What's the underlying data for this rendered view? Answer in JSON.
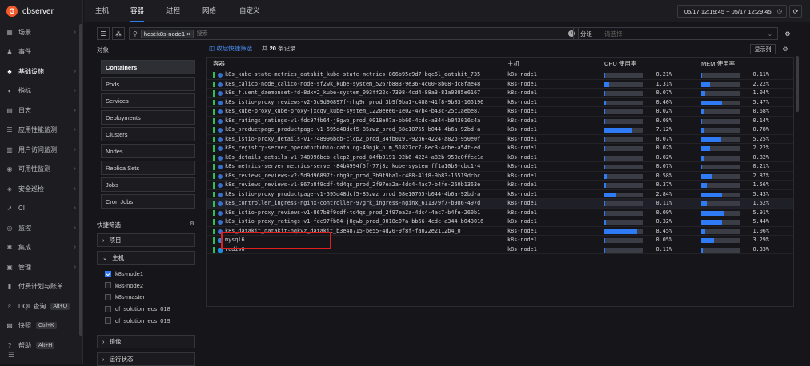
{
  "app": {
    "name": "observer"
  },
  "nav": [
    {
      "label": "场景",
      "icon": "scene-icon",
      "glyph": "▦",
      "chevron": true
    },
    {
      "label": "事件",
      "icon": "bell-icon",
      "glyph": "♟",
      "chevron": false
    },
    {
      "label": "基础设施",
      "icon": "infra-icon",
      "glyph": "♣",
      "chevron": true,
      "active": true
    },
    {
      "label": "指标",
      "icon": "metric-icon",
      "glyph": "◐",
      "chevron": true
    },
    {
      "label": "日志",
      "icon": "log-icon",
      "glyph": "▤",
      "chevron": true
    },
    {
      "label": "应用性能监测",
      "icon": "apm-icon",
      "glyph": "☰",
      "chevron": true
    },
    {
      "label": "用户访问监测",
      "icon": "rum-icon",
      "glyph": "▥",
      "chevron": true
    },
    {
      "label": "可用性监测",
      "icon": "dial-icon",
      "glyph": "◉",
      "chevron": true
    },
    {
      "label": "安全巡检",
      "icon": "shield-icon",
      "glyph": "◈",
      "chevron": true
    },
    {
      "label": "CI",
      "icon": "rocket-icon",
      "glyph": "➚",
      "chevron": true
    },
    {
      "label": "监控",
      "icon": "monitor-icon",
      "glyph": "◎",
      "chevron": true
    },
    {
      "label": "集成",
      "icon": "puzzle-icon",
      "glyph": "✱",
      "chevron": true
    },
    {
      "label": "管理",
      "icon": "manage-icon",
      "glyph": "▣",
      "chevron": true
    },
    {
      "label": "付费计划与账单",
      "icon": "billing-icon",
      "glyph": "▮",
      "chevron": false
    },
    {
      "label": "DQL 查询",
      "icon": "dql-icon",
      "glyph": "⌕",
      "chevron": false,
      "kbd": "Alt+Q"
    },
    {
      "label": "快照",
      "icon": "snapshot-icon",
      "glyph": "▩",
      "chevron": false,
      "kbd": "Ctrl+K"
    },
    {
      "label": "帮助",
      "icon": "help-icon",
      "glyph": "?",
      "chevron": false,
      "kbd": "Alt+H"
    }
  ],
  "tabs": [
    "主机",
    "容器",
    "进程",
    "网络",
    "自定义"
  ],
  "active_tab": "容器",
  "time_range": "05/17 12:19:45 ~ 05/17 12:29:45",
  "filter": {
    "chip": "host:k8s-node1",
    "search_placeholder": "搜索",
    "group_label": "分组",
    "group_placeholder": "请选择"
  },
  "objects_label": "对象",
  "objects": [
    "Containers",
    "Pods",
    "Services",
    "Deployments",
    "Clusters",
    "Nodes",
    "Replica Sets",
    "Jobs",
    "Cron Jobs"
  ],
  "quick_filter": {
    "title": "快捷筛选",
    "project": "项目",
    "host": "主机",
    "hosts": [
      {
        "name": "k8s-node1",
        "checked": true
      },
      {
        "name": "k8s-node2",
        "checked": false
      },
      {
        "name": "k8s-master",
        "checked": false
      },
      {
        "name": "df_solution_ecs_018",
        "checked": false
      },
      {
        "name": "df_solution_ecs_019",
        "checked": false
      }
    ],
    "image": "镜像",
    "run_state": "运行状态"
  },
  "table_top": {
    "view_link": "收起快捷筛选",
    "count_prefix": "共 ",
    "count": "20",
    "count_suffix": " 条记录",
    "columns_btn": "显示列"
  },
  "columns": {
    "name": "容器",
    "host": "主机",
    "cpu": "CPU 使用率",
    "mem": "MEM 使用率"
  },
  "rows": [
    {
      "name": "k8s_kube-state-metrics_datakit_kube-state-metrics-866b95c9d7-bqc6l_datakit_735",
      "host": "k8s-node1",
      "cpu": 0.21,
      "mem": 0.11,
      "type": "k8s"
    },
    {
      "name": "k8s_calico-node_calico-node-sf2wk_kube-system_5267b883-9e36-4c00-8b08-dc8fae48",
      "host": "k8s-node1",
      "cpu": 1.31,
      "mem": 2.22,
      "type": "k8s"
    },
    {
      "name": "k8s_fluent_daemonset-fd-8dxv2_kube-system_093ff22c-7398-4cd4-88a3-81a0085e6167",
      "host": "k8s-node1",
      "cpu": 0.07,
      "mem": 1.04,
      "type": "k8s"
    },
    {
      "name": "k8s_istio-proxy_reviews-v2-5d9d96897f-rhg9r_prod_3b9f9ba1-c488-41f8-9b83-165196",
      "host": "k8s-node1",
      "cpu": 0.4,
      "mem": 5.47,
      "type": "k8s"
    },
    {
      "name": "k8s_kube-proxy_kube-proxy-jxcqv_kube-system_1220eee6-1e02-47b4-b43c-25c1aebe87",
      "host": "k8s-node1",
      "cpu": 0.02,
      "mem": 0.68,
      "type": "k8s"
    },
    {
      "name": "k8s_ratings_ratings-v1-fdc97fb64-j8gwb_prod_0018e07a-bb66-4cdc-a344-b043016c4a",
      "host": "k8s-node1",
      "cpu": 0.08,
      "mem": 0.14,
      "type": "k8s"
    },
    {
      "name": "k8s_productpage_productpage-v1-595d48dcf5-85zwz_prod_68e10765-b044-4b6a-92bd-a",
      "host": "k8s-node1",
      "cpu": 7.12,
      "mem": 0.78,
      "type": "k8s"
    },
    {
      "name": "k8s_istio-proxy_details-v1-748996bcb-clcp2_prod_84fb0191-92b6-4224-a82b-950e0f",
      "host": "k8s-node1",
      "cpu": 0.07,
      "mem": 5.25,
      "type": "k8s"
    },
    {
      "name": "k8s_registry-server_operatorhubio-catalog-49njk_olm_51827cc7-8ec3-4cbe-a54f-ed",
      "host": "k8s-node1",
      "cpu": 0.02,
      "mem": 2.22,
      "type": "k8s"
    },
    {
      "name": "k8s_details_details-v1-748996bcb-clcp2_prod_84fb0191-92b6-4224-a82b-950e0ffee1a",
      "host": "k8s-node1",
      "cpu": 0.02,
      "mem": 0.82,
      "type": "k8s"
    },
    {
      "name": "k8s_metrics-server_metrics-server-84b4994f5f-77j8z_kube-system_ff1a10b0-cbc1-4",
      "host": "k8s-node1",
      "cpu": 0.07,
      "mem": 0.21,
      "type": "k8s"
    },
    {
      "name": "k8s_reviews_reviews-v2-5d9d96897f-rhg9r_prod_3b9f9ba1-c488-41f8-9b83-16519dcbc",
      "host": "k8s-node1",
      "cpu": 0.58,
      "mem": 2.87,
      "type": "k8s"
    },
    {
      "name": "k8s_reviews_reviews-v1-867b8f9cdf-td4qs_prod_2f97ea2a-4dc4-4ac7-b4fe-260b1363e",
      "host": "k8s-node1",
      "cpu": 0.37,
      "mem": 1.56,
      "type": "k8s"
    },
    {
      "name": "k8s_istio-proxy_productpage-v1-595d48dcf5-85zwz_prod_68e10765-b044-4b6a-92bd-a",
      "host": "k8s-node1",
      "cpu": 2.84,
      "mem": 5.43,
      "type": "k8s"
    },
    {
      "name": "k8s_controller_ingress-nginx-controller-97grk_ingress-nginx_611379f7-b986-497d",
      "host": "k8s-node1",
      "cpu": 0.11,
      "mem": 1.52,
      "type": "k8s",
      "highlight": true
    },
    {
      "name": "k8s_istio-proxy_reviews-v1-867b8f9cdf-td4qs_prod_2f97ea2a-4dc4-4ac7-b4fe-260b1",
      "host": "k8s-node1",
      "cpu": 0.09,
      "mem": 5.91,
      "type": "k8s"
    },
    {
      "name": "k8s_istio-proxy_ratings-v1-fdc97fb64-j8gwb_prod_0018e07a-bb66-4cdc-a344-b043016",
      "host": "k8s-node1",
      "cpu": 0.32,
      "mem": 5.44,
      "type": "k8s"
    },
    {
      "name": "k8s_datakit_datakit-nqkvz_datakit_b3e48715-be55-4d20-9f8f-fa022e2112b4_0",
      "host": "k8s-node1",
      "cpu": 8.45,
      "mem": 1.06,
      "type": "k8s"
    },
    {
      "name": "mysql6",
      "host": "k8s-node1",
      "cpu": 0.05,
      "mem": 3.29,
      "type": "docker"
    },
    {
      "name": "redis6",
      "host": "k8s-node1",
      "cpu": 0.11,
      "mem": 0.33,
      "type": "docker"
    }
  ],
  "colors": {
    "accent": "#2f7bf6",
    "status_running": "#2fbf5a",
    "highlight_box": "#e02020",
    "brand": "#f25a2c"
  }
}
